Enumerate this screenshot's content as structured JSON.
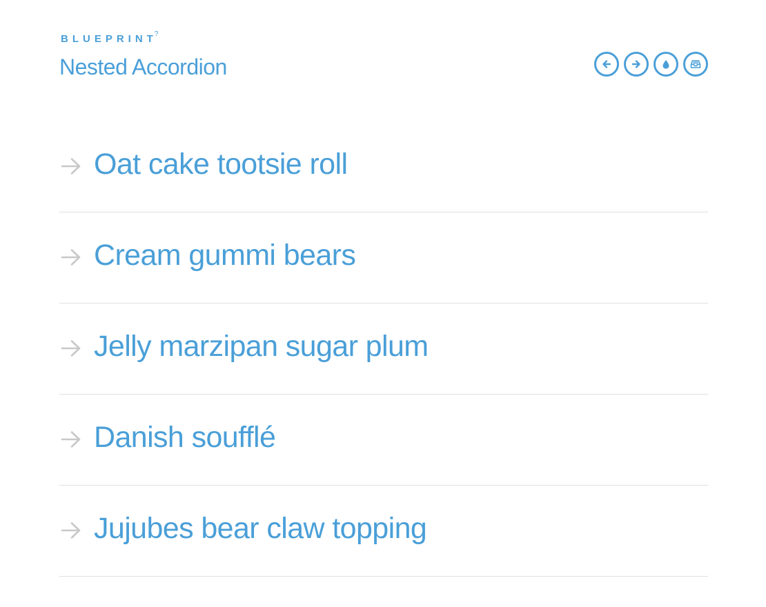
{
  "header": {
    "brand": "BLUEPRINT",
    "brand_mark": "?",
    "title": "Nested Accordion"
  },
  "toolbar": {
    "buttons": [
      {
        "icon": "arrow-left-icon"
      },
      {
        "icon": "arrow-right-icon"
      },
      {
        "icon": "droplet-icon"
      },
      {
        "icon": "inbox-icon"
      }
    ]
  },
  "accordion": {
    "items": [
      {
        "label": "Oat cake tootsie roll"
      },
      {
        "label": "Cream gummi bears"
      },
      {
        "label": "Jelly marzipan sugar plum"
      },
      {
        "label": "Danish soufflé"
      },
      {
        "label": "Jujubes bear claw topping"
      }
    ]
  },
  "colors": {
    "accent": "#4a9fd8",
    "arrow": "#c8c8c8",
    "divider": "#e0e0e0"
  }
}
